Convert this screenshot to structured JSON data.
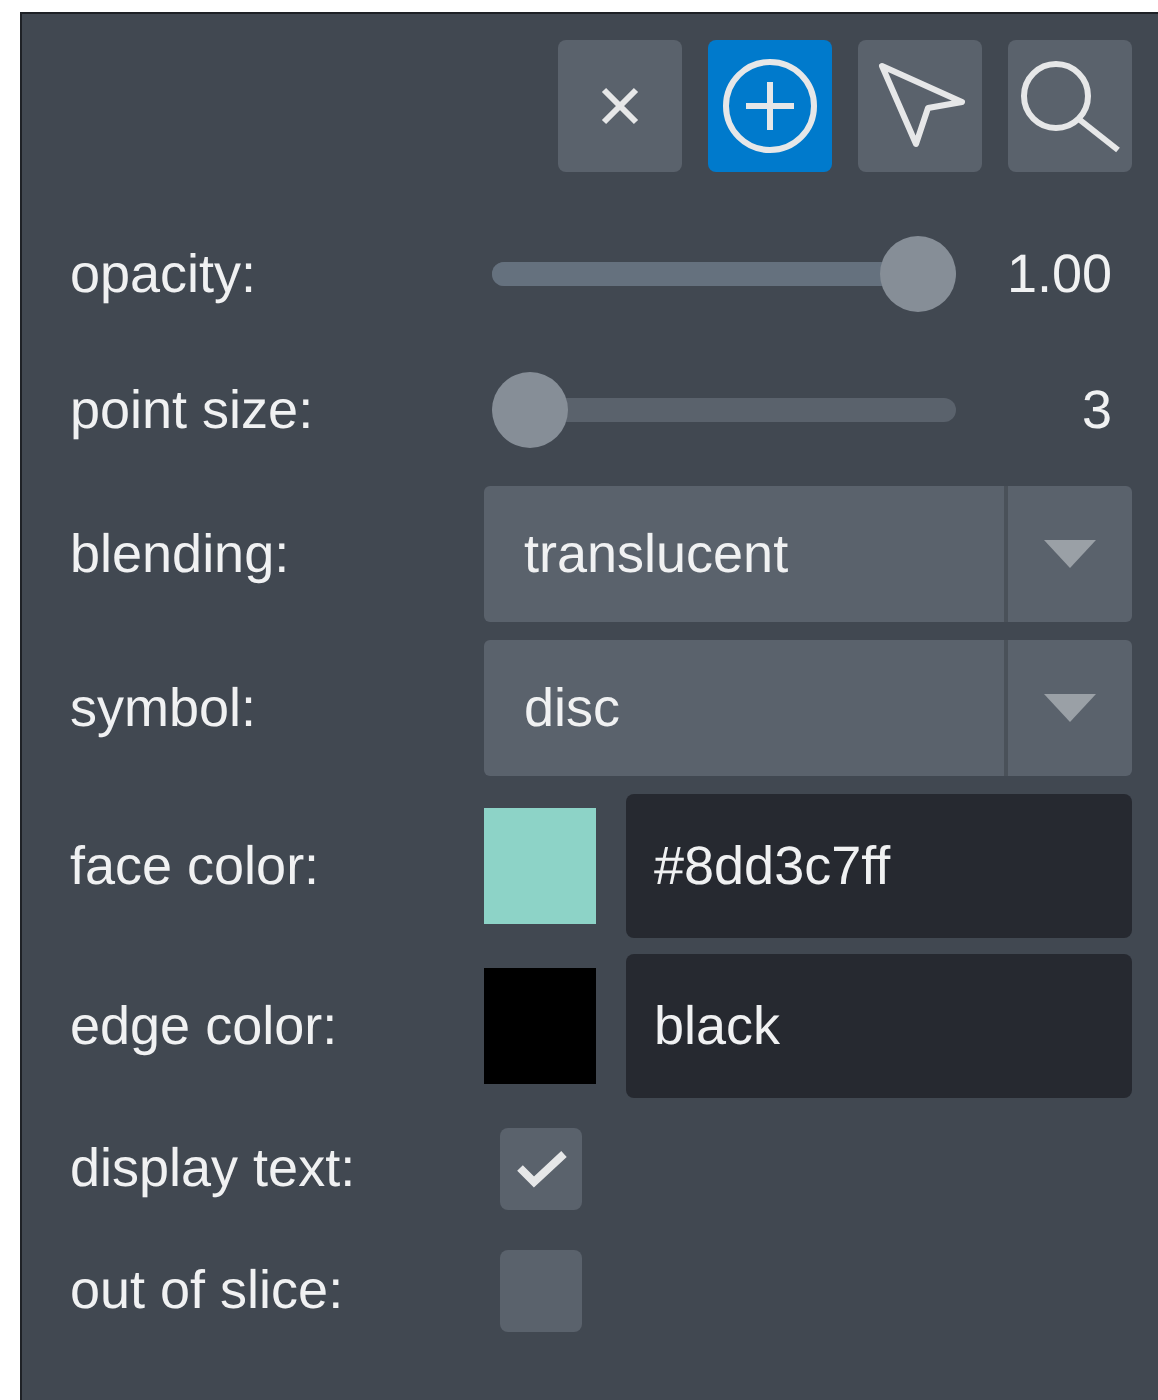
{
  "mode_buttons": [
    {
      "kind": "delete",
      "selected": false
    },
    {
      "kind": "add",
      "selected": true
    },
    {
      "kind": "select",
      "selected": false
    },
    {
      "kind": "pan_zoom",
      "selected": false
    }
  ],
  "controls": [
    {
      "kind": "slider",
      "label": "opacity:",
      "level": 1.0,
      "reading": "1.00"
    },
    {
      "kind": "slider",
      "label": "point size:",
      "level": 0.0,
      "reading": "3"
    },
    {
      "kind": "dropdown",
      "label": "blending:",
      "value": "translucent"
    },
    {
      "kind": "dropdown",
      "label": "symbol:",
      "value": "disc"
    },
    {
      "kind": "color",
      "label": "face color:",
      "color": "#8dd3c7",
      "value": "#8dd3c7ff"
    },
    {
      "kind": "color",
      "label": "edge color:",
      "color": "#000000",
      "value": "black"
    },
    {
      "kind": "checkbox",
      "label": "display text:",
      "checked": true
    },
    {
      "kind": "checkbox",
      "label": "out of slice:",
      "checked": false
    }
  ]
}
